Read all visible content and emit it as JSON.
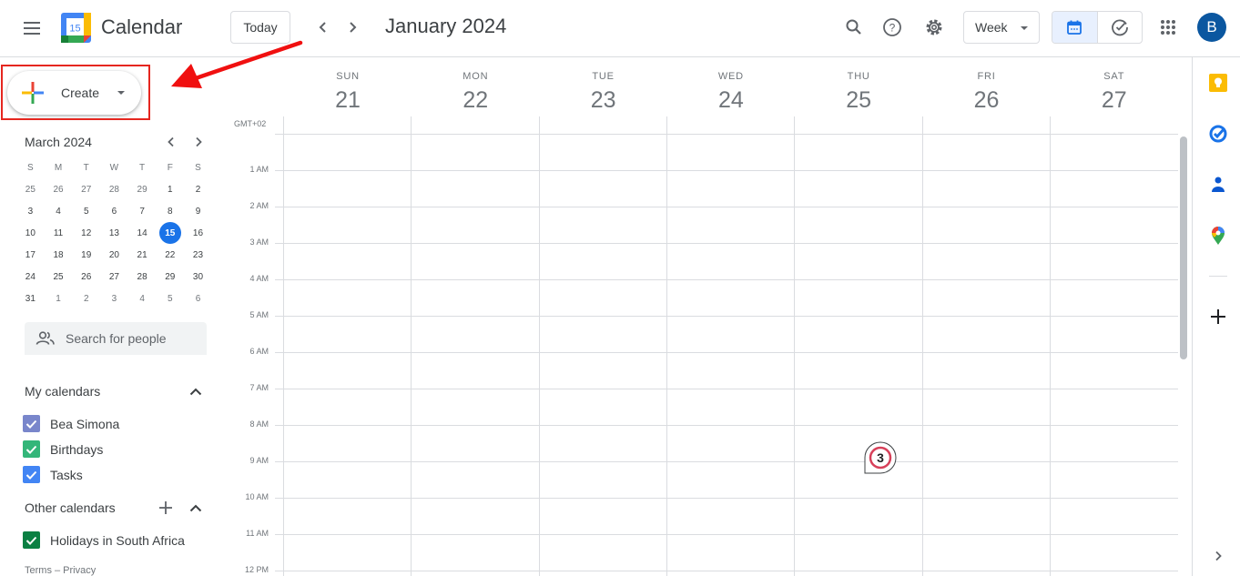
{
  "header": {
    "app_title": "Calendar",
    "logo_day": "15",
    "today_label": "Today",
    "period_title": "January 2024",
    "view_select": "Week",
    "avatar_initial": "B",
    "icons": [
      "menu-icon",
      "search-icon",
      "help-icon",
      "settings-icon",
      "calendar-view-icon",
      "tasks-view-icon",
      "apps-grid-icon"
    ]
  },
  "create": {
    "label": "Create"
  },
  "mini_calendar": {
    "title": "March 2024",
    "weekdays": [
      "S",
      "M",
      "T",
      "W",
      "T",
      "F",
      "S"
    ],
    "weeks": [
      [
        "25",
        "26",
        "27",
        "28",
        "29",
        "1",
        "2"
      ],
      [
        "3",
        "4",
        "5",
        "6",
        "7",
        "8",
        "9"
      ],
      [
        "10",
        "11",
        "12",
        "13",
        "14",
        "15",
        "16"
      ],
      [
        "17",
        "18",
        "19",
        "20",
        "21",
        "22",
        "23"
      ],
      [
        "24",
        "25",
        "26",
        "27",
        "28",
        "29",
        "30"
      ],
      [
        "31",
        "1",
        "2",
        "3",
        "4",
        "5",
        "6"
      ]
    ],
    "selected": "15"
  },
  "people_search": {
    "placeholder": "Search for people"
  },
  "my_calendars": {
    "title": "My calendars",
    "items": [
      {
        "label": "Bea Simona",
        "color": "#7986cb"
      },
      {
        "label": "Birthdays",
        "color": "#33b679"
      },
      {
        "label": "Tasks",
        "color": "#4285f4"
      }
    ]
  },
  "other_calendars": {
    "title": "Other calendars",
    "items": [
      {
        "label": "Holidays in South Africa",
        "color": "#0b8043"
      }
    ]
  },
  "footer": {
    "terms": "Terms – Privacy"
  },
  "week": {
    "timezone": "GMT+02",
    "days": [
      {
        "dow": "SUN",
        "num": "21"
      },
      {
        "dow": "MON",
        "num": "22"
      },
      {
        "dow": "TUE",
        "num": "23"
      },
      {
        "dow": "WED",
        "num": "24"
      },
      {
        "dow": "THU",
        "num": "25"
      },
      {
        "dow": "FRI",
        "num": "26"
      },
      {
        "dow": "SAT",
        "num": "27"
      }
    ],
    "hours": [
      "1 AM",
      "2 AM",
      "3 AM",
      "4 AM",
      "5 AM",
      "6 AM",
      "7 AM",
      "8 AM",
      "9 AM",
      "10 AM",
      "11 AM",
      "12 PM"
    ]
  },
  "annotation": {
    "step_number": "3"
  },
  "side_panel": {
    "icons": [
      "keep-icon",
      "tasks-icon",
      "contacts-icon",
      "maps-icon",
      "add-addon-icon",
      "expand-panel-icon"
    ]
  }
}
